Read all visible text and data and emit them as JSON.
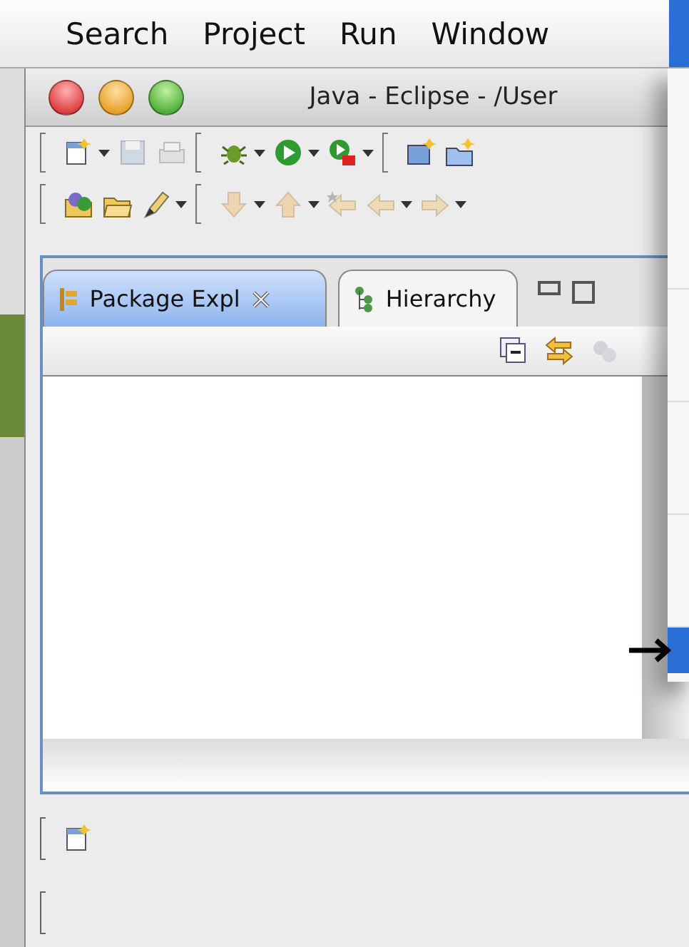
{
  "menu_bar": {
    "items": [
      {
        "label": "Search",
        "selected": false
      },
      {
        "label": "Project",
        "selected": false
      },
      {
        "label": "Run",
        "selected": false
      },
      {
        "label": "Window",
        "selected": false
      }
    ],
    "open_menu_selected": true
  },
  "open_menu": {
    "rows": [
      {
        "selected": false
      },
      {
        "selected": false
      },
      {
        "selected": false
      },
      {
        "selected": false
      },
      {
        "selected": true
      }
    ]
  },
  "window": {
    "title": "Java - Eclipse - /User",
    "toolbars": [
      [
        [
          {
            "kind": "new",
            "dropdown": true,
            "disabled": false
          },
          {
            "kind": "save",
            "dropdown": false,
            "disabled": true
          },
          {
            "kind": "print",
            "dropdown": false,
            "disabled": true
          }
        ],
        [
          {
            "kind": "debug",
            "dropdown": true,
            "disabled": false
          },
          {
            "kind": "run",
            "dropdown": true,
            "disabled": false
          },
          {
            "kind": "external",
            "dropdown": true,
            "disabled": false
          }
        ],
        [
          {
            "kind": "new-project",
            "dropdown": false,
            "disabled": false
          },
          {
            "kind": "new-folder",
            "dropdown": false,
            "disabled": false
          }
        ]
      ],
      [
        [
          {
            "kind": "open-type",
            "dropdown": false,
            "disabled": false
          },
          {
            "kind": "open-folder",
            "dropdown": false,
            "disabled": false
          },
          {
            "kind": "pen",
            "dropdown": true,
            "disabled": false
          }
        ],
        [
          {
            "kind": "down",
            "dropdown": true,
            "disabled": true
          },
          {
            "kind": "up",
            "dropdown": true,
            "disabled": true
          },
          {
            "kind": "last-edit",
            "dropdown": false,
            "disabled": true
          },
          {
            "kind": "back",
            "dropdown": true,
            "disabled": true
          },
          {
            "kind": "forward",
            "dropdown": true,
            "disabled": true
          }
        ]
      ]
    ],
    "tabs": [
      {
        "label": "Package Expl",
        "selected": true,
        "closable": true
      },
      {
        "label": "Hierarchy",
        "selected": false,
        "closable": false
      }
    ],
    "view_toolbar": [
      {
        "kind": "collapse",
        "disabled": false
      },
      {
        "kind": "link",
        "disabled": false
      },
      {
        "kind": "filter",
        "disabled": true
      }
    ]
  }
}
